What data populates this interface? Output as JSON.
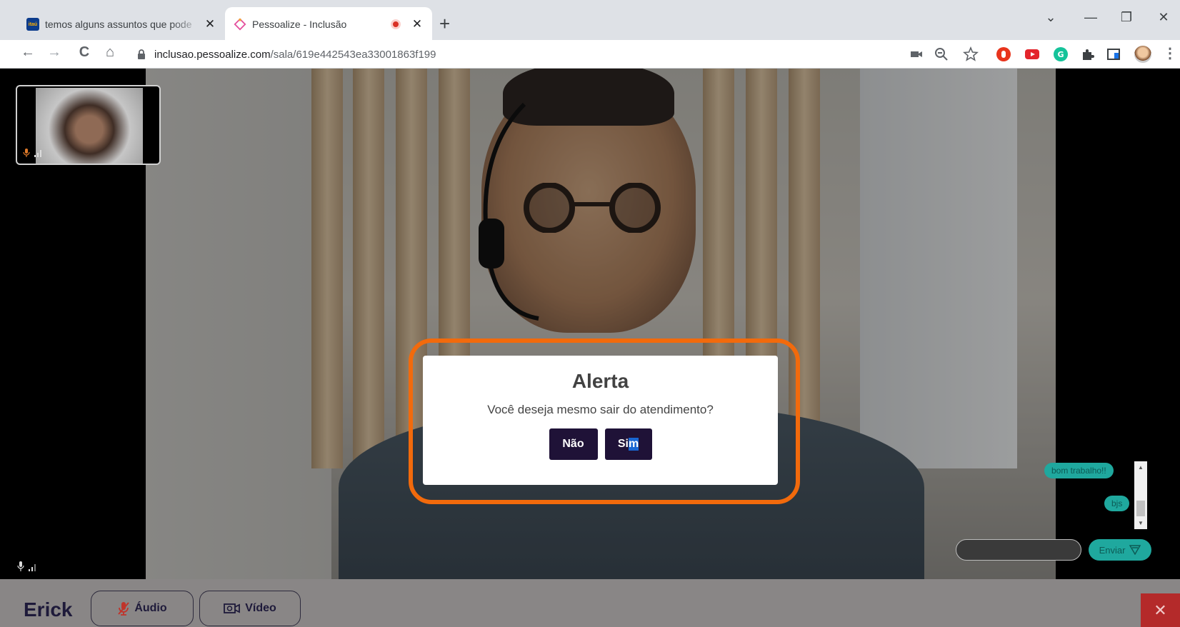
{
  "browser": {
    "tabs": [
      {
        "favicon": "itau-logo",
        "favicon_text": "itaú",
        "title": "temos alguns assuntos que pode",
        "close": "✕"
      },
      {
        "favicon": "pessoalize-logo",
        "title": "Pessoalize - Inclusão",
        "recording_indicator": "red-dot",
        "close": "✕"
      }
    ],
    "new_tab": "+",
    "window_controls": {
      "dropdown": "⌄",
      "minimize": "—",
      "restore": "❐",
      "close": "✕"
    },
    "nav": {
      "back": "←",
      "forward": "→",
      "reload": "C",
      "home": "⌂"
    },
    "url": {
      "host": "inclusao.pessoalize.com",
      "path": "/sala/619e442543ea33001863f199"
    },
    "toolbar_icons": [
      "camera-icon",
      "zoom-icon",
      "star-icon",
      "adblock-extension-icon",
      "youtube-extension-icon",
      "grammarly-extension-icon",
      "puzzle-extensions-icon",
      "reading-list-icon",
      "profile-avatar-icon",
      "menu-icon"
    ],
    "menu": "⋮"
  },
  "meeting": {
    "participant_name": "Erick",
    "audio_label": "Áudio",
    "video_label": "Vídeo",
    "leave_label": "✕"
  },
  "chat": {
    "messages": [
      "bom trabalho!!",
      "bjs"
    ],
    "input_placeholder": "",
    "send_label": "Enviar"
  },
  "modal": {
    "title": "Alerta",
    "message": "Você deseja mesmo sair do atendimento?",
    "no_label": "Não",
    "yes_label_prefix": "Si",
    "yes_label_selected": "m"
  },
  "colors": {
    "modal_button": "#1f1237",
    "highlight": "#f26a0c",
    "chat_accent": "#1fa89e",
    "leave_button": "#b42a2a"
  }
}
